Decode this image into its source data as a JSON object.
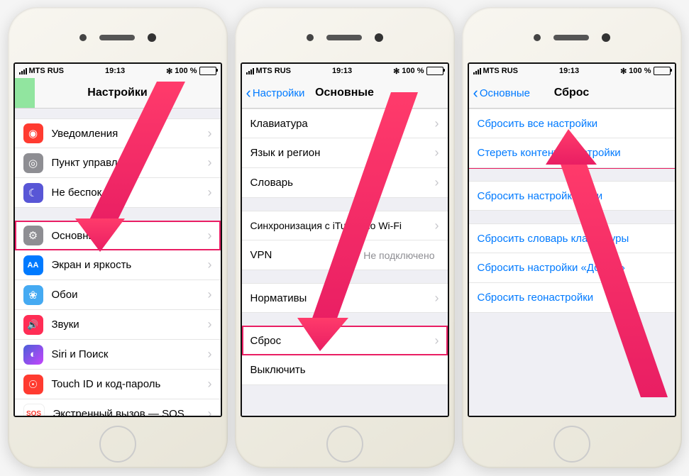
{
  "status": {
    "carrier": "MTS RUS",
    "time": "19:13",
    "battery_pct": "100 %",
    "bluetooth": "✻"
  },
  "phone1": {
    "title": "Настройки",
    "rows": [
      {
        "icon_bg": "#ff3b30",
        "icon": "◉",
        "label": "Уведомления"
      },
      {
        "icon_bg": "#8e8e93",
        "icon": "◎",
        "label": "Пункт управления"
      },
      {
        "icon_bg": "#5856d6",
        "icon": "☾",
        "label": "Не беспок"
      }
    ],
    "rows2": [
      {
        "icon_bg": "#8e8e93",
        "icon": "⚙",
        "label": "Основные",
        "highlight": true
      },
      {
        "icon_bg": "#007aff",
        "icon": "AA",
        "label": "Экран и яркость"
      },
      {
        "icon_bg": "#45aaf2",
        "icon": "❀",
        "label": "Обои"
      },
      {
        "icon_bg": "#ff2d55",
        "icon": "🔊",
        "label": "Звуки"
      },
      {
        "icon_bg": "#222",
        "icon": "◐",
        "label": "Siri и Поиск"
      },
      {
        "icon_bg": "#ff3b30",
        "icon": "☉",
        "label": "Touch ID и код-пароль"
      },
      {
        "icon_bg": "#fff",
        "icon": "SOS",
        "label": "Экстренный вызов — SOS",
        "icon_fg": "#ff3b30"
      }
    ]
  },
  "phone2": {
    "back": "Настройки",
    "title": "Основные",
    "rows": [
      {
        "label": "Клавиатура"
      },
      {
        "label": "Язык и регион"
      },
      {
        "label": "Словарь"
      }
    ],
    "rows2": [
      {
        "label": "Синхронизация с iTunes по Wi-Fi"
      },
      {
        "label": "VPN",
        "value": "Не подключено",
        "no_chevron": true
      }
    ],
    "rows3": [
      {
        "label": "Нормативы"
      }
    ],
    "rows4": [
      {
        "label": "Сброс",
        "highlight": true
      },
      {
        "label": "Выключить",
        "no_chevron": true
      }
    ]
  },
  "phone3": {
    "back": "Основные",
    "title": "Сброс",
    "group1": [
      {
        "label": "Сбросить все настройки"
      },
      {
        "label": "Стереть контент и настройки"
      }
    ],
    "group2": [
      {
        "label": "Сбросить настройки сети"
      }
    ],
    "group3": [
      {
        "label": "Сбросить словарь клавиатуры"
      },
      {
        "label": "Сбросить настройки «Домой»"
      },
      {
        "label": "Сбросить геонастройки"
      }
    ]
  },
  "colors": {
    "accent": "#e91e63",
    "link": "#007aff"
  }
}
